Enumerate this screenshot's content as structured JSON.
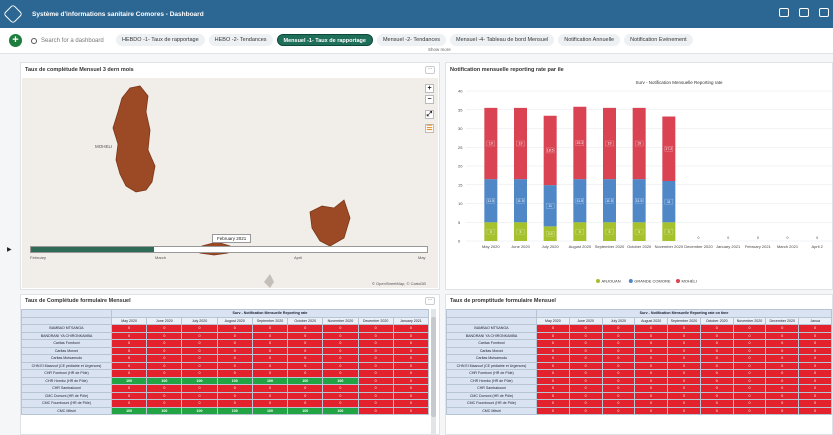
{
  "app": {
    "title": "Système d'informations sanitaire Comores - Dashboard"
  },
  "dashbar": {
    "search_placeholder": "Search for a dashboard",
    "chips": [
      {
        "label": "HEBDO -1- Taux de rapportage",
        "active": false
      },
      {
        "label": "HEBO -2- Tendances",
        "active": false
      },
      {
        "label": "Mensuel -1- Taux de rapportage",
        "active": true
      },
      {
        "label": "Mensuel -2- Tendances",
        "active": false
      },
      {
        "label": "Mensuel -4- Tableau de bord Mensuel",
        "active": false
      },
      {
        "label": "Notification Annuelle",
        "active": false
      },
      {
        "label": "Notification Evénement",
        "active": false
      }
    ],
    "show_more": "Show more"
  },
  "map_panel": {
    "title": "Taux de complétude Mensuel 3 dern mois",
    "menu": "···",
    "label_moheli": "MOHELI",
    "tooltip": "February 2021",
    "timeline_labels": [
      "February",
      "March",
      "April",
      "May"
    ],
    "timeline_progress": 0.31,
    "attribution": "© OpenStreetMap, © CartoDB",
    "controls": [
      "+",
      "−",
      "⤢",
      "☰"
    ]
  },
  "chart_panel": {
    "title": "Notification mensuelle reporting rate par ile",
    "menu": "···"
  },
  "chart_data": {
    "type": "bar",
    "title": "Surv - Notification Mensuelle Reporting rate",
    "categories": [
      "May 2020",
      "June 2020",
      "July 2020",
      "August 2020",
      "September 2020",
      "October 2020",
      "November 2020",
      "December 2020",
      "January 2021",
      "February 2021",
      "March 2021",
      "April 2"
    ],
    "series": [
      {
        "name": "ANJOUAN",
        "color": "#a5c12b",
        "values": [
          5,
          5,
          3.9,
          5,
          5,
          5,
          5,
          0,
          0,
          0,
          0,
          0
        ]
      },
      {
        "name": "GRANDE COMORE",
        "color": "#4f87c7",
        "values": [
          11.5,
          11.5,
          11,
          11.5,
          11.5,
          11.5,
          11,
          0,
          0,
          0,
          0,
          0
        ]
      },
      {
        "name": "MOHÉLI",
        "color": "#d94352",
        "values": [
          19,
          19,
          18.5,
          19.3,
          19,
          19,
          17.2,
          0,
          0,
          0,
          0,
          0
        ]
      }
    ],
    "segment_labels": [
      [
        "5",
        "11.5",
        "19"
      ],
      [
        "5",
        "11.5",
        "19"
      ],
      [
        "3.9",
        "11",
        "18.5"
      ],
      [
        "5",
        "11.5",
        "19.3"
      ],
      [
        "5",
        "11.5",
        "19"
      ],
      [
        "5",
        "11.5",
        "19"
      ],
      [
        "5",
        "11",
        "17.2"
      ],
      [
        "",
        "",
        "0"
      ],
      [
        "",
        "",
        "0"
      ],
      [
        "",
        "",
        "0"
      ],
      [
        "",
        "",
        "0"
      ],
      [
        "",
        "",
        "0"
      ]
    ],
    "ylim": [
      0,
      40
    ],
    "yticks": [
      0,
      5,
      10,
      15,
      20,
      25,
      30,
      35,
      40
    ],
    "stacked": true,
    "legend_position": "bottom"
  },
  "table1": {
    "title": "Taux de Complétude formulaire Mensuel",
    "caption": "Surv - Notification Mensuelle Reporting rate",
    "menu": "···",
    "columns": [
      "May 2020",
      "June 2020",
      "July 2020",
      "August 2020",
      "September 2020",
      "October 2020",
      "November 2020",
      "December 2020",
      "January 2021"
    ],
    "rows": [
      {
        "label": "BAMBAO MTSANGA",
        "values": [
          "0",
          "0",
          "0",
          "0",
          "0",
          "0",
          "0",
          "0",
          "0"
        ]
      },
      {
        "label": "BANDRANI YA CHIRONKAMBA",
        "values": [
          "0",
          "0",
          "0",
          "0",
          "0",
          "0",
          "0",
          "0",
          "0"
        ]
      },
      {
        "label": "Caritas Fomboni",
        "values": [
          "0",
          "0",
          "0",
          "0",
          "0",
          "0",
          "0",
          "0",
          "0"
        ]
      },
      {
        "label": "Caritas Moroni",
        "values": [
          "0",
          "0",
          "0",
          "0",
          "0",
          "0",
          "0",
          "0",
          "0"
        ]
      },
      {
        "label": "Caritas Mutsamudu",
        "values": [
          "0",
          "0",
          "0",
          "0",
          "0",
          "0",
          "0",
          "0",
          "0"
        ]
      },
      {
        "label": "CHN El Maarouf (CE pédiatrie et Urgences)",
        "values": [
          "0",
          "0",
          "0",
          "0",
          "0",
          "0",
          "0",
          "0",
          "0"
        ]
      },
      {
        "label": "CHR Fomboni (HR de Pôle)",
        "values": [
          "0",
          "0",
          "0",
          "0",
          "0",
          "0",
          "0",
          "0",
          "0"
        ]
      },
      {
        "label": "CHR Hombo (HR de Pôle)",
        "values": [
          "100",
          "100",
          "100",
          "100",
          "100",
          "100",
          "100",
          "0",
          "0"
        ]
      },
      {
        "label": "CHR Sambakouni",
        "values": [
          "0",
          "0",
          "0",
          "0",
          "0",
          "0",
          "0",
          "0",
          "0"
        ]
      },
      {
        "label": "CMC Domoni (HR de Pôle)",
        "values": [
          "0",
          "0",
          "0",
          "0",
          "0",
          "0",
          "0",
          "0",
          "0"
        ]
      },
      {
        "label": "CMC Foumbouni (HR de Pôle)",
        "values": [
          "0",
          "0",
          "0",
          "0",
          "0",
          "0",
          "0",
          "0",
          "0"
        ]
      },
      {
        "label": "CMC Mitsiri",
        "values": [
          "100",
          "100",
          "100",
          "100",
          "100",
          "100",
          "100",
          "0",
          "0"
        ]
      }
    ]
  },
  "table2": {
    "title": "Taux de promptitude formulaire Mensuel",
    "caption": "Surv - Notification Mensuelle Reporting rate on time",
    "columns": [
      "May 2020",
      "June 2020",
      "July 2020",
      "August 2020",
      "September 2020",
      "October 2020",
      "November 2020",
      "December 2020",
      "Janua"
    ],
    "rows": [
      {
        "label": "BAMBAO MTSANGA",
        "values": [
          "0",
          "0",
          "0",
          "0",
          "0",
          "0",
          "0",
          "0",
          "0"
        ]
      },
      {
        "label": "BANDRANI YA CHIRONKAMBA",
        "values": [
          "0",
          "0",
          "0",
          "0",
          "0",
          "0",
          "0",
          "0",
          "0"
        ]
      },
      {
        "label": "Caritas Fomboni",
        "values": [
          "0",
          "0",
          "0",
          "0",
          "0",
          "0",
          "0",
          "0",
          "0"
        ]
      },
      {
        "label": "Caritas Moroni",
        "values": [
          "0",
          "0",
          "0",
          "0",
          "0",
          "0",
          "0",
          "0",
          "0"
        ]
      },
      {
        "label": "Caritas Mutsamudu",
        "values": [
          "0",
          "0",
          "0",
          "0",
          "0",
          "0",
          "0",
          "0",
          "0"
        ]
      },
      {
        "label": "CHN El Maarouf (CE pédiatrie et Urgences)",
        "values": [
          "0",
          "0",
          "0",
          "0",
          "0",
          "0",
          "0",
          "0",
          "0"
        ]
      },
      {
        "label": "CHR Fomboni (HR de Pôle)",
        "values": [
          "0",
          "0",
          "0",
          "0",
          "0",
          "0",
          "0",
          "0",
          "0"
        ]
      },
      {
        "label": "CHR Hombo (HR de Pôle)",
        "values": [
          "0",
          "0",
          "0",
          "0",
          "0",
          "0",
          "0",
          "0",
          "0"
        ]
      },
      {
        "label": "CHR Sambakouni",
        "values": [
          "0",
          "0",
          "0",
          "0",
          "0",
          "0",
          "0",
          "0",
          "0"
        ]
      },
      {
        "label": "CMC Domoni (HR de Pôle)",
        "values": [
          "0",
          "0",
          "0",
          "0",
          "0",
          "0",
          "0",
          "0",
          "0"
        ]
      },
      {
        "label": "CMC Foumbouni (HR de Pôle)",
        "values": [
          "0",
          "0",
          "0",
          "0",
          "0",
          "0",
          "0",
          "0",
          "0"
        ]
      },
      {
        "label": "CMC Mitsiri",
        "values": [
          "0",
          "0",
          "0",
          "0",
          "0",
          "0",
          "0",
          "0",
          "0"
        ]
      }
    ]
  }
}
